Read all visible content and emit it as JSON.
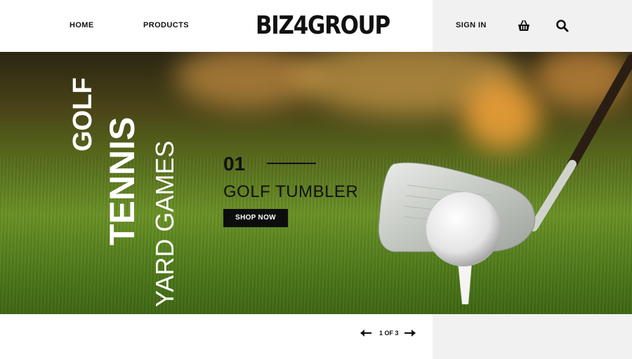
{
  "nav": {
    "home": "HOME",
    "products": "PRODUCTS",
    "logo": "BIZ4GROUP",
    "sign_in": "SIGN IN",
    "cart_icon": "basket-icon",
    "search_icon": "search-icon"
  },
  "hero": {
    "categories": [
      "GOLF",
      "TENNIS",
      "YARD GAMES"
    ],
    "slide_number": "01",
    "slide_title": "GOLF TUMBLER",
    "cta_label": "SHOP NOW"
  },
  "pager": {
    "text": "1 OF 3",
    "prev_icon": "arrow-left-icon",
    "next_icon": "arrow-right-icon"
  },
  "colors": {
    "text": "#111111",
    "button_bg": "#0d0d0d",
    "header_right_bg": "#f1f1f1"
  }
}
